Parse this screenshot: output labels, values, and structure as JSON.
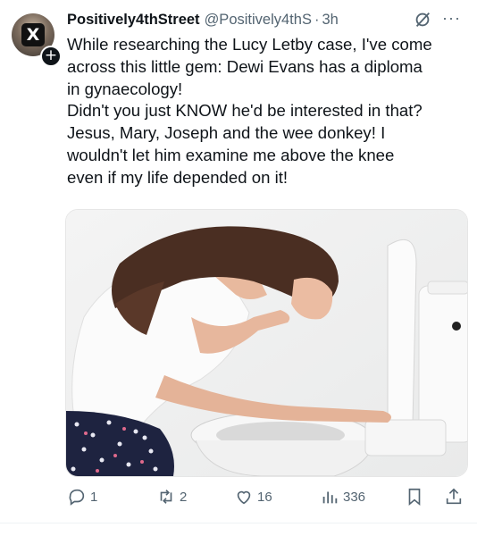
{
  "tweet": {
    "author_name": "Positively4thStreet",
    "author_handle": "@Positively4thS",
    "separator": "·",
    "time": "3h",
    "lines": [
      "While researching the Lucy Letby case, I've come",
      "across this little gem: Dewi Evans has a diploma",
      "in gynaecology!",
      "Didn't you just KNOW he'd be interested in that?",
      "Jesus, Mary, Joseph and the wee donkey! I",
      "wouldn't let him examine me above the knee",
      "even if my life depended on it!"
    ]
  },
  "media": {
    "description_icon": "photo-of-woman-leaning-over-toilet"
  },
  "actions": {
    "reply_count": "1",
    "repost_count": "2",
    "like_count": "16",
    "views_count": "336"
  },
  "icons": {
    "avatar_badge": "X",
    "follow": "+",
    "more": "···"
  },
  "colors": {
    "text": "#0f1419",
    "secondary": "#536471",
    "divider": "#eff3f4"
  }
}
